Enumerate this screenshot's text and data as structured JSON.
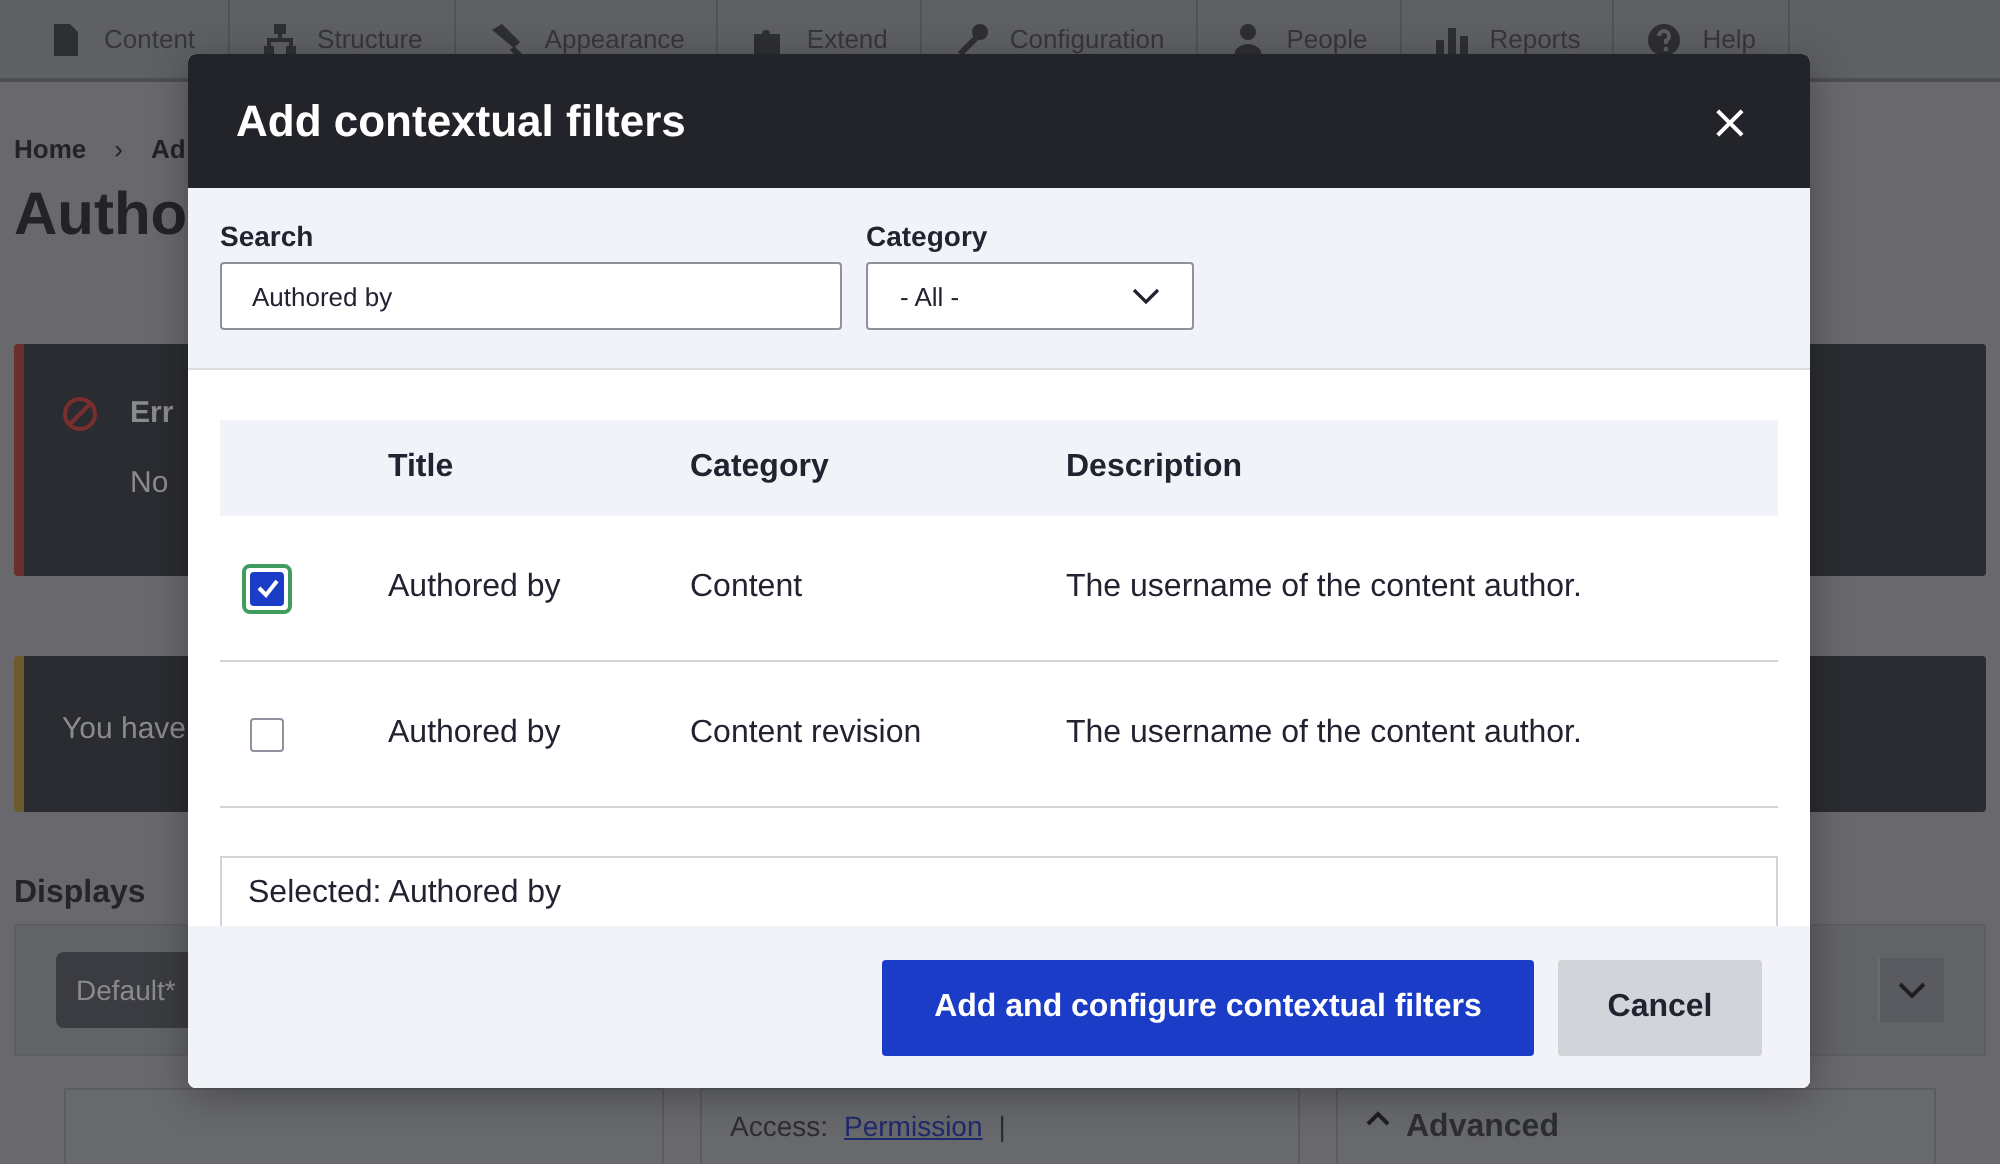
{
  "toolbar": {
    "items": [
      {
        "label": "Content"
      },
      {
        "label": "Structure"
      },
      {
        "label": "Appearance"
      },
      {
        "label": "Extend"
      },
      {
        "label": "Configuration"
      },
      {
        "label": "People"
      },
      {
        "label": "Reports"
      },
      {
        "label": "Help"
      }
    ]
  },
  "breadcrumb": {
    "items": [
      "Home",
      "Ad"
    ],
    "separator": "›"
  },
  "page_title": "Autho",
  "messages": [
    {
      "kind": "error",
      "title": "Err",
      "text": "No"
    },
    {
      "kind": "warning",
      "text": "You have"
    }
  ],
  "displays": {
    "label": "Displays",
    "tabs": [
      {
        "label": "Default*",
        "selected": true
      }
    ]
  },
  "columns": [
    {
      "kind": "blank"
    },
    {
      "kind": "access",
      "label": "Access:",
      "link": "Permission",
      "separator": "|"
    },
    {
      "kind": "advanced",
      "label": "Advanced"
    }
  ],
  "dialog": {
    "title": "Add contextual filters",
    "close": "×",
    "search": {
      "label": "Search",
      "value": "Authored by"
    },
    "category": {
      "label": "Category",
      "value": "- All -"
    },
    "table": {
      "columns": [
        "Title",
        "Category",
        "Description"
      ],
      "rows": [
        {
          "checked": true,
          "focused": true,
          "title": "Authored by",
          "category": "Content",
          "description": "The username of the content author."
        },
        {
          "checked": false,
          "focused": false,
          "title": "Authored by",
          "category": "Content revision",
          "description": "The username of the content author."
        }
      ]
    },
    "selected_text": "Selected: Authored by",
    "buttons": [
      {
        "kind": "primary",
        "label": "Add and configure contextual filters"
      },
      {
        "kind": "secondary",
        "label": "Cancel"
      }
    ]
  }
}
